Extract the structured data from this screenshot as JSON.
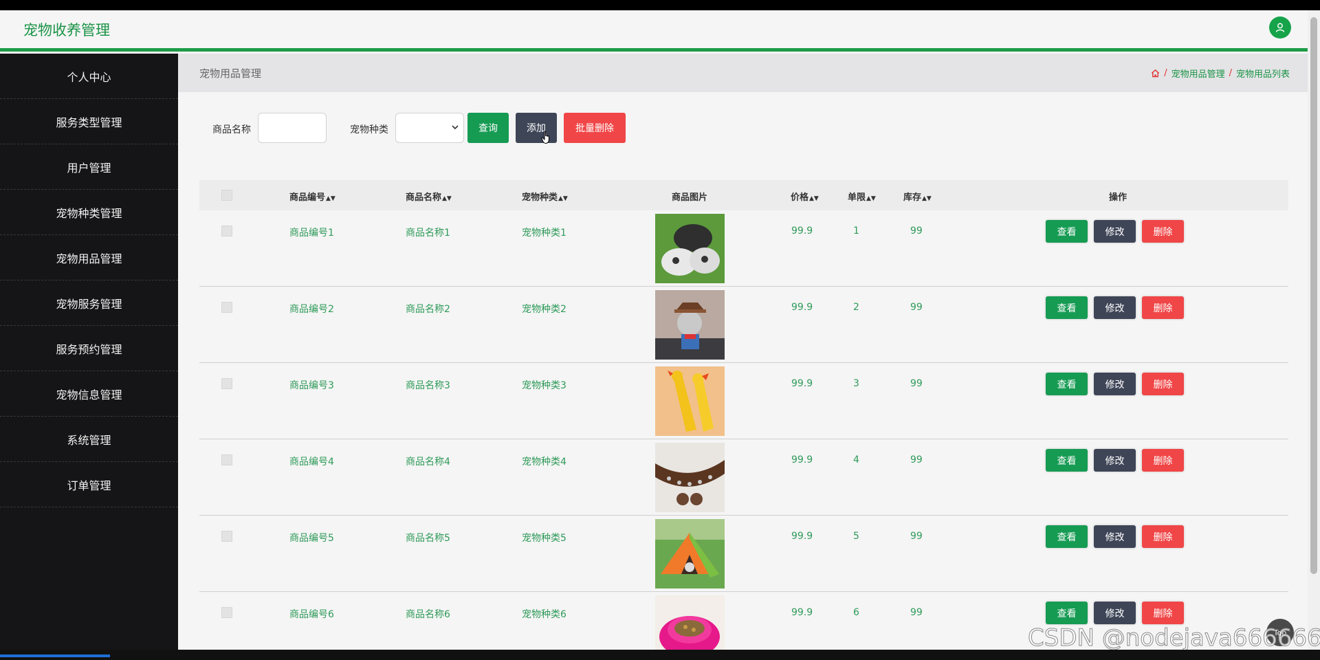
{
  "app": {
    "title": "宠物收养管理"
  },
  "sidebar": {
    "items": [
      {
        "label": "个人中心"
      },
      {
        "label": "服务类型管理"
      },
      {
        "label": "用户管理"
      },
      {
        "label": "宠物种类管理"
      },
      {
        "label": "宠物用品管理"
      },
      {
        "label": "宠物服务管理"
      },
      {
        "label": "服务预约管理"
      },
      {
        "label": "宠物信息管理"
      },
      {
        "label": "系统管理"
      },
      {
        "label": "订单管理"
      }
    ]
  },
  "page": {
    "title": "宠物用品管理",
    "breadcrumb": [
      "宠物用品管理",
      "宠物用品列表"
    ]
  },
  "search": {
    "name_label": "商品名称",
    "name_value": "",
    "type_label": "宠物种类",
    "type_value": "",
    "query_btn": "查询",
    "add_btn": "添加",
    "batch_delete_btn": "批量删除"
  },
  "table": {
    "headers": {
      "code": "商品编号",
      "name": "商品名称",
      "type": "宠物种类",
      "image": "商品图片",
      "price": "价格",
      "limit": "单限",
      "stock": "库存",
      "actions": "操作"
    },
    "rows": [
      {
        "code": "商品编号1",
        "name": "商品名称1",
        "type": "宠物种类1",
        "image": "slippers",
        "price": "99.9",
        "limit": "1",
        "stock": "99"
      },
      {
        "code": "商品编号2",
        "name": "商品名称2",
        "type": "宠物种类2",
        "image": "cat-costume",
        "price": "99.9",
        "limit": "2",
        "stock": "99"
      },
      {
        "code": "商品编号3",
        "name": "商品名称3",
        "type": "宠物种类3",
        "image": "rubber-chicken",
        "price": "99.9",
        "limit": "3",
        "stock": "99"
      },
      {
        "code": "商品编号4",
        "name": "商品名称4",
        "type": "宠物种类4",
        "image": "collar",
        "price": "99.9",
        "limit": "4",
        "stock": "99"
      },
      {
        "code": "商品编号5",
        "name": "商品名称5",
        "type": "宠物种类5",
        "image": "pet-tent",
        "price": "99.9",
        "limit": "5",
        "stock": "99"
      },
      {
        "code": "商品编号6",
        "name": "商品名称6",
        "type": "宠物种类6",
        "image": "pet-bowl",
        "price": "99.9",
        "limit": "6",
        "stock": "99"
      }
    ],
    "row_actions": {
      "view": "查看",
      "edit": "修改",
      "delete": "删除"
    }
  },
  "misc": {
    "top_label": "Top",
    "watermark": "CSDN @nodejava666666"
  },
  "colors": {
    "brand": "#1a9346",
    "accent_green": "#169b53",
    "dark": "#3e4557",
    "danger": "#f04647",
    "sidebar_bg": "#151517"
  }
}
